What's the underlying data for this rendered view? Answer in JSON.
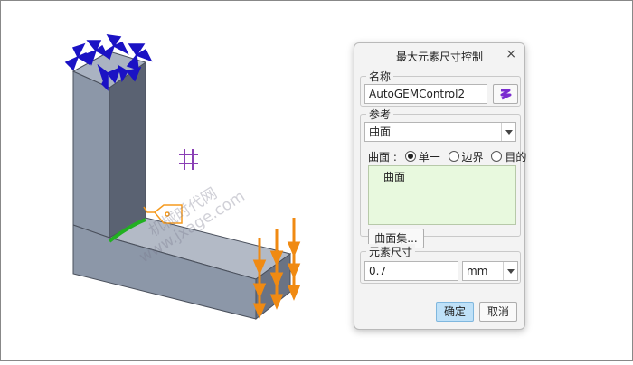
{
  "dialog": {
    "title": "最大元素尺寸控制",
    "close_symbol": "×",
    "name_section": {
      "legend": "名称",
      "value": "AutoGEMControl2"
    },
    "reference_section": {
      "legend": "参考",
      "type_value": "曲面",
      "filter_label": "曲面 :",
      "filter_options": [
        "单一",
        "边界",
        "目的"
      ],
      "filter_selected": "单一",
      "collected_item": "曲面",
      "surface_set_button": "曲面集..."
    },
    "element_size_section": {
      "legend": "元素尺寸",
      "value": "0.7",
      "unit": "mm"
    },
    "ok_button": "确定",
    "cancel_button": "取消"
  },
  "watermark": {
    "line1": "机械时代网",
    "line2": "www.jxage.com"
  },
  "colors": {
    "part_front": "#8c97a8",
    "part_side": "#5a6272",
    "part_top": "#aab3c2",
    "constraint": "#1b12c4",
    "load": "#f08a12",
    "tag": "#f59a1e",
    "coord": "#8a3fb5",
    "edge_highlight": "#21b021",
    "ok_button": "#bfe1f8"
  }
}
